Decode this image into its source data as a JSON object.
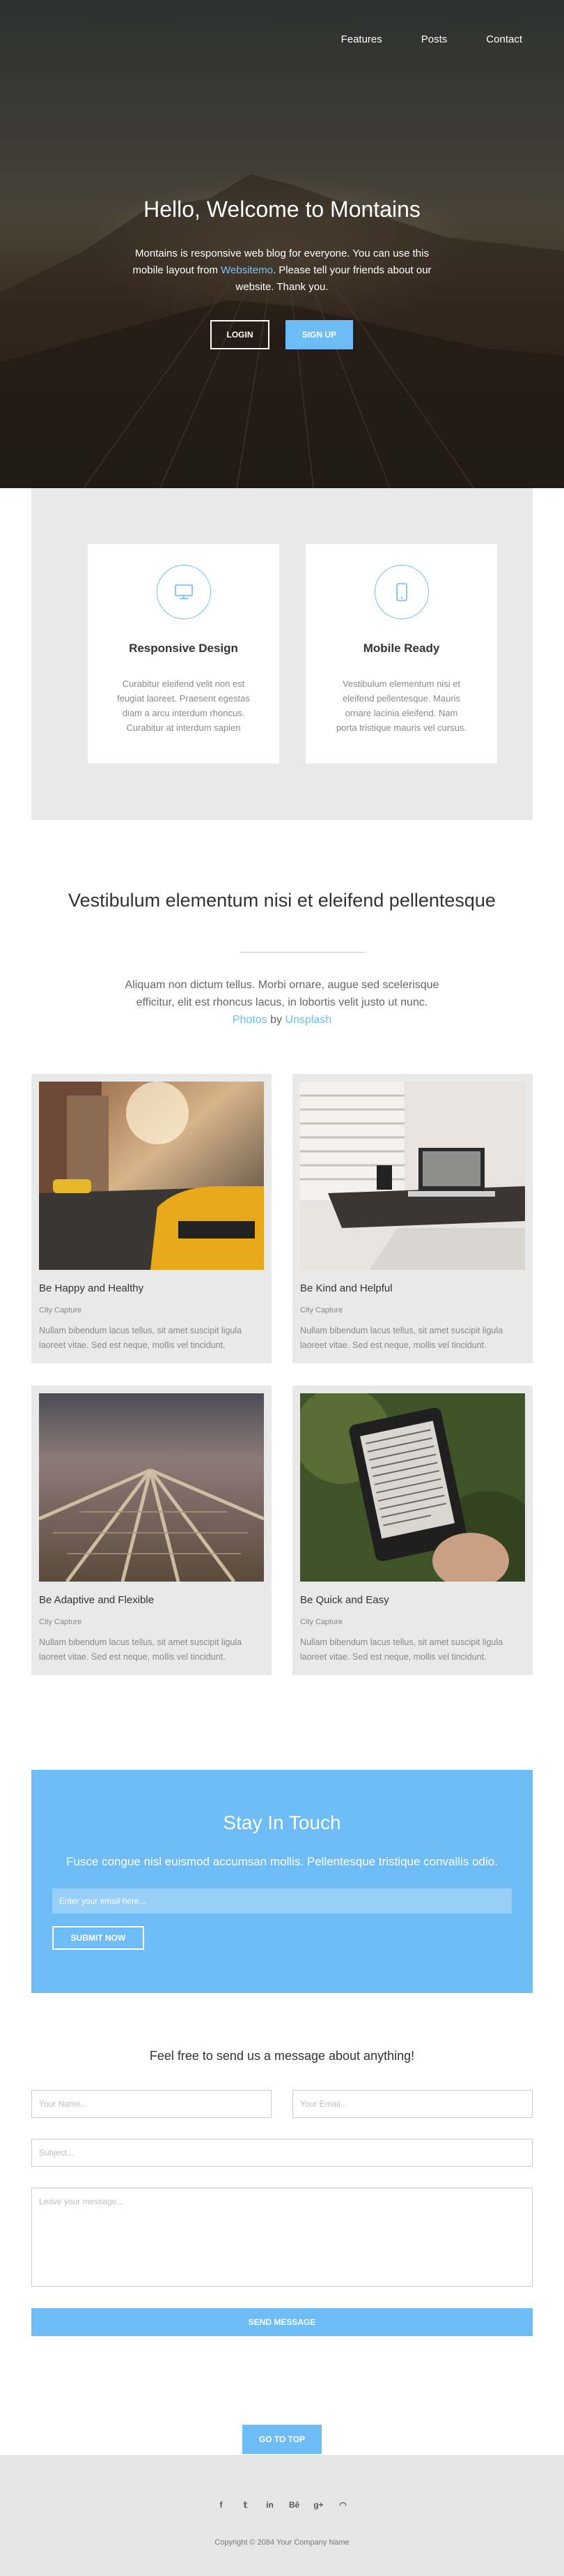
{
  "nav": {
    "items": [
      "Features",
      "Posts",
      "Contact"
    ]
  },
  "hero": {
    "title": "Hello, Welcome to Montains",
    "intro_before": "Montains is responsive web blog for everyone. You can use this mobile layout from ",
    "intro_link": "Websitemo",
    "intro_after": ". Please tell your friends about our website. Thank you.",
    "login_label": "LOGIN",
    "signup_label": "SIGN UP"
  },
  "features": [
    {
      "icon": "monitor-icon",
      "title": "Responsive Design",
      "text": "Curabitur eleifend velit non est feugiat laoreet. Praesent egestas diam a arcu interdum rhoncus. Curabitur at interdum sapien"
    },
    {
      "icon": "mobile-icon",
      "title": "Mobile Ready",
      "text": "Vestibulum elementum nisi et eleifend pellentesque. Mauris ornare lacinia eleifend. Nam porta tristique mauris vel cursus."
    }
  ],
  "section": {
    "title": "Vestibulum elementum nisi et eleifend pellentesque",
    "text_before": "Aliquam non dictum tellus. Morbi ornare, augue sed scelerisque efficitur, elit est rhoncus lacus, in lobortis velit justo ut nunc. ",
    "link1": "Photos",
    "by": " by ",
    "link2": "Unsplash"
  },
  "gallery": [
    {
      "title": "Be Happy and Healthy",
      "sub": "City Capture",
      "text": "Nullam bibendum lacus tellus, sit amet suscipit ligula laoreet vitae. Sed est neque, mollis vel tincidunt."
    },
    {
      "title": "Be Kind and Helpful",
      "sub": "City Capture",
      "text": "Nullam bibendum lacus tellus, sit amet suscipit ligula laoreet vitae. Sed est neque, mollis vel tincidunt."
    },
    {
      "title": "Be Adaptive and Flexible",
      "sub": "City Capture",
      "text": "Nullam bibendum lacus tellus, sit amet suscipit ligula laoreet vitae. Sed est neque, mollis vel tincidunt."
    },
    {
      "title": "Be Quick and Easy",
      "sub": "City Capture",
      "text": "Nullam bibendum lacus tellus, sit amet suscipit ligula laoreet vitae. Sed est neque, mollis vel tincidunt."
    }
  ],
  "newsletter": {
    "title": "Stay In Touch",
    "text": "Fusce congue nisl euismod accumsan mollis. Pellentesque tristique convallis odio.",
    "email_placeholder": "Enter your email here...",
    "submit_label": "SUBMIT NOW"
  },
  "contact": {
    "title": "Feel free to send us a message about anything!",
    "name_placeholder": "Your Name...",
    "email_placeholder": "Your Email...",
    "subject_placeholder": "Subject...",
    "message_placeholder": "Leave your message...",
    "send_label": "SEND MESSAGE"
  },
  "to_top_label": "GO TO TOP",
  "footer": {
    "social": [
      {
        "icon": "facebook-icon",
        "glyph": "f"
      },
      {
        "icon": "twitter-icon",
        "glyph": "𝕥"
      },
      {
        "icon": "linkedin-icon",
        "glyph": "in"
      },
      {
        "icon": "behance-icon",
        "glyph": "Bē"
      },
      {
        "icon": "google-plus-icon",
        "glyph": "g+"
      },
      {
        "icon": "rss-icon",
        "glyph": "◠"
      }
    ],
    "copyright": "Copyright © 2084 Your Company Name"
  },
  "colors": {
    "accent": "#6dbcf5",
    "panel": "#e9e9e9"
  }
}
